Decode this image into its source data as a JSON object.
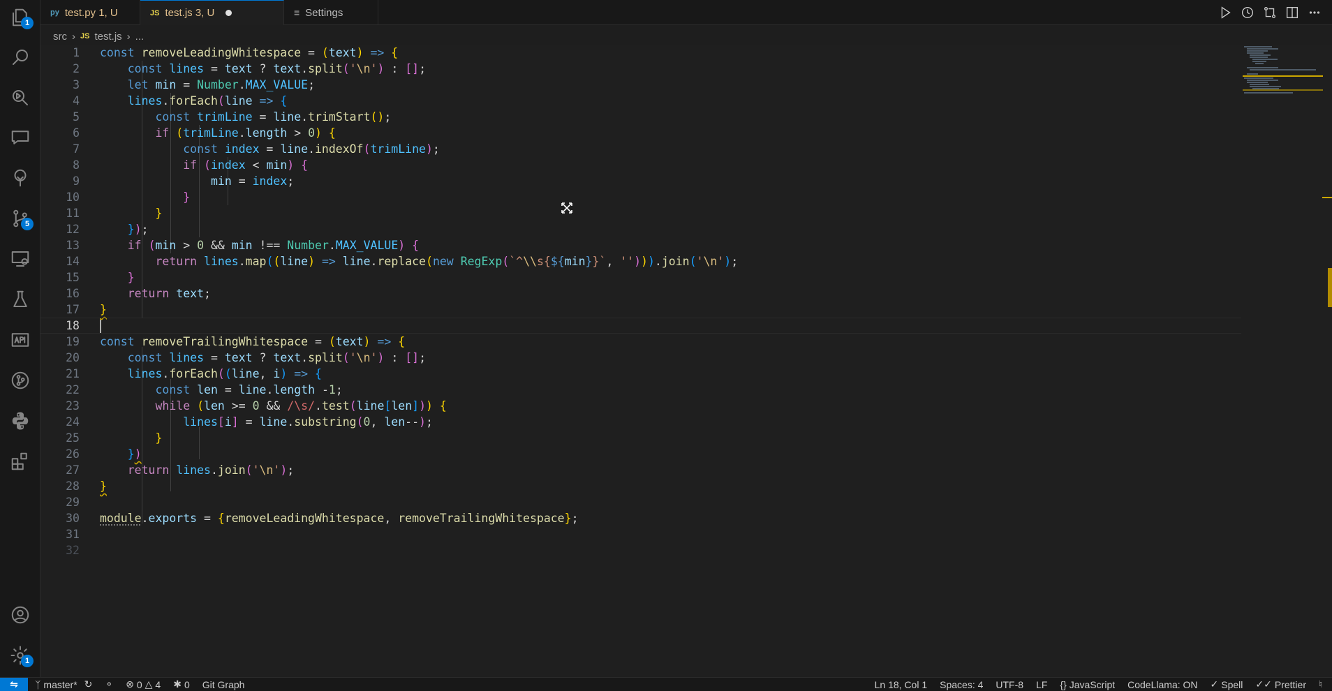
{
  "tabs": [
    {
      "icon": "py",
      "label": "test.py 1, U"
    },
    {
      "icon": "JS",
      "label": "test.js 3, U"
    },
    {
      "icon": "settings",
      "label": "Settings"
    }
  ],
  "breadcrumb": {
    "folder": "src",
    "file_icon": "JS",
    "file": "test.js",
    "more": "..."
  },
  "activity_badges": {
    "explorer": "1",
    "source_control": "5",
    "settings": "1"
  },
  "code": {
    "current_line": 18,
    "lines": [
      "1",
      "2",
      "3",
      "4",
      "5",
      "6",
      "7",
      "8",
      "9",
      "10",
      "11",
      "12",
      "13",
      "14",
      "15",
      "16",
      "17",
      "18",
      "19",
      "20",
      "21",
      "22",
      "23",
      "24",
      "25",
      "26",
      "27",
      "28",
      "29",
      "30",
      "31",
      "32"
    ]
  },
  "status": {
    "remote_icon": "remote-icon",
    "branch": "master*",
    "errors": "0",
    "warnings": "4",
    "ports": "0",
    "git_graph": "Git Graph",
    "position": "Ln 18, Col 1",
    "spaces": "Spaces: 4",
    "encoding": "UTF-8",
    "eol": "LF",
    "language": "JavaScript",
    "codellama": "CodeLlama: ON",
    "spell": "Spell",
    "prettier": "Prettier"
  },
  "colors": {
    "accent": "#0078d4",
    "background": "#1f1f1f",
    "warning": "#cca700"
  }
}
